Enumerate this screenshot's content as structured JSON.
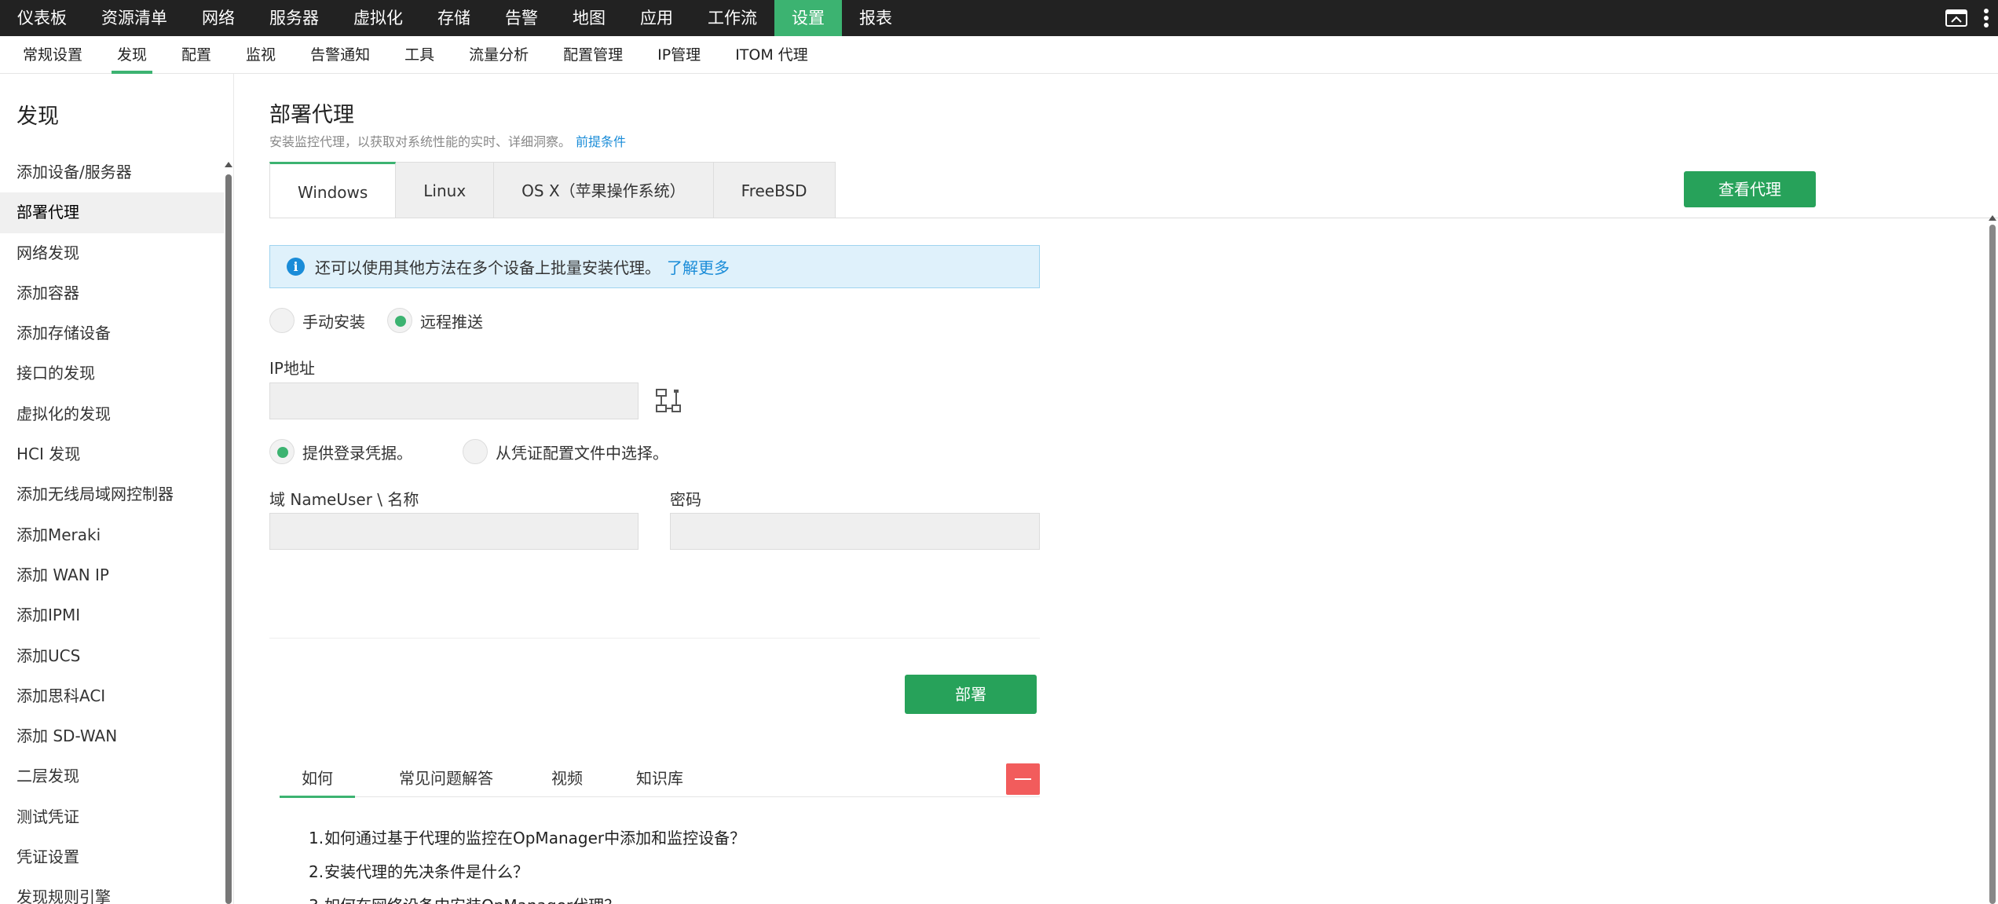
{
  "topnav": {
    "items": [
      "仪表板",
      "资源清单",
      "网络",
      "服务器",
      "虚拟化",
      "存储",
      "告警",
      "地图",
      "应用",
      "工作流",
      "设置",
      "报表"
    ],
    "active_index": 10
  },
  "subnav": {
    "items": [
      "常规设置",
      "发现",
      "配置",
      "监视",
      "告警通知",
      "工具",
      "流量分析",
      "配置管理",
      "IP管理",
      "ITOM 代理"
    ],
    "active_index": 1
  },
  "sidebar": {
    "title": "发现",
    "items": [
      "添加设备/服务器",
      "部署代理",
      "网络发现",
      "添加容器",
      "添加存储设备",
      "接口的发现",
      "虚拟化的发现",
      "HCI 发现",
      "添加无线局域网控制器",
      "添加Meraki",
      "添加 WAN IP",
      "添加IPMI",
      "添加UCS",
      "添加思科ACI",
      "添加 SD-WAN",
      "二层发现",
      "测试凭证",
      "凭证设置",
      "发现规则引擎"
    ],
    "active_index": 1
  },
  "main": {
    "title": "部署代理",
    "subtitle": "安装监控代理，以获取对系统性能的实时、详细洞察。",
    "prereq_link": "前提条件",
    "tabs": [
      "Windows",
      "Linux",
      "OS X（苹果操作系统）",
      "FreeBSD"
    ],
    "active_tab": 0,
    "view_agents_button": "查看代理",
    "info_text": "还可以使用其他方法在多个设备上批量安装代理。",
    "info_link": "了解更多",
    "install_mode": {
      "manual": "手动安装",
      "remote": "远程推送",
      "selected": "remote"
    },
    "ip_label": "IP地址",
    "ip_value": "",
    "cred_mode": {
      "provide": "提供登录凭据。",
      "from_profile": "从凭证配置文件中选择。",
      "selected": "provide"
    },
    "domain_label": "域 NameUser \\ 名称",
    "domain_value": "",
    "password_label": "密码",
    "password_value": "",
    "deploy_button": "部署"
  },
  "help": {
    "tabs": [
      "如何",
      "常见问题解答",
      "视频",
      "知识库"
    ],
    "active_tab": 0,
    "items": [
      {
        "num": "1.",
        "text": "如何通过基于代理的监控在OpManager中添加和监控设备？"
      },
      {
        "num": "2.",
        "text": "安装代理的先决条件是什么？"
      },
      {
        "num": "3.",
        "text": "如何在网络设备中安装OpManager代理？"
      }
    ]
  },
  "colors": {
    "accent": "#3cb371",
    "button": "#27a25a",
    "link": "#1a8cd8",
    "danger": "#f25c5c",
    "topbar": "#222222"
  }
}
